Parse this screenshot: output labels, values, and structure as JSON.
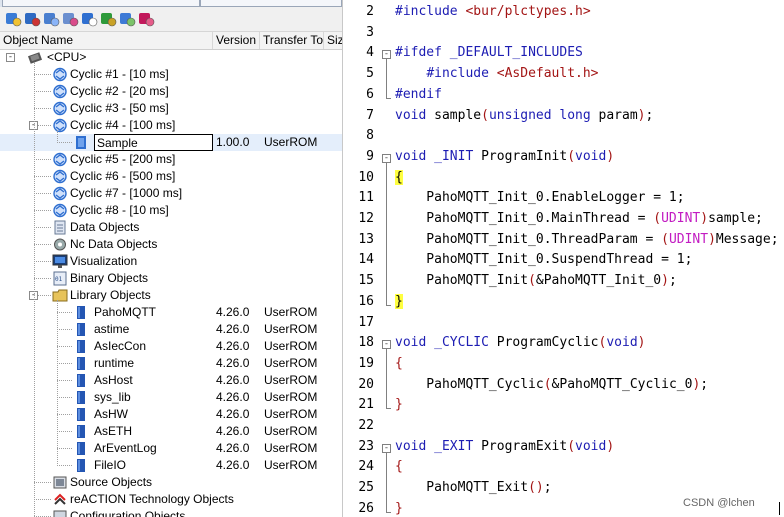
{
  "left_pane": {
    "columns": [
      "Object Name",
      "Version",
      "Transfer To",
      "Size"
    ],
    "tree": [
      {
        "label": "<CPU>",
        "version": "",
        "transfer": "",
        "icon": "cpu-icon",
        "expander": "-"
      },
      {
        "label": "Cyclic #1 - [10 ms]",
        "version": "",
        "transfer": "",
        "icon": "cyclic-icon"
      },
      {
        "label": "Cyclic #2 - [20 ms]",
        "version": "",
        "transfer": "",
        "icon": "cyclic-icon"
      },
      {
        "label": "Cyclic #3 - [50 ms]",
        "version": "",
        "transfer": "",
        "icon": "cyclic-icon"
      },
      {
        "label": "Cyclic #4 - [100 ms]",
        "version": "",
        "transfer": "",
        "icon": "cyclic-icon",
        "expander": "-"
      },
      {
        "label": "Sample",
        "version": "1.00.0",
        "transfer": "UserROM",
        "icon": "program-icon",
        "selected": true
      },
      {
        "label": "Cyclic #5 - [200 ms]",
        "version": "",
        "transfer": "",
        "icon": "cyclic-icon"
      },
      {
        "label": "Cyclic #6 - [500 ms]",
        "version": "",
        "transfer": "",
        "icon": "cyclic-icon"
      },
      {
        "label": "Cyclic #7 - [1000 ms]",
        "version": "",
        "transfer": "",
        "icon": "cyclic-icon"
      },
      {
        "label": "Cyclic #8 - [10 ms]",
        "version": "",
        "transfer": "",
        "icon": "cyclic-icon"
      },
      {
        "label": "Data Objects",
        "version": "",
        "transfer": "",
        "icon": "data-objects-icon"
      },
      {
        "label": "Nc Data Objects",
        "version": "",
        "transfer": "",
        "icon": "nc-data-icon"
      },
      {
        "label": "Visualization",
        "version": "",
        "transfer": "",
        "icon": "visualization-icon"
      },
      {
        "label": "Binary Objects",
        "version": "",
        "transfer": "",
        "icon": "binary-objects-icon"
      },
      {
        "label": "Library Objects",
        "version": "",
        "transfer": "",
        "icon": "library-objects-icon",
        "expander": "-"
      },
      {
        "label": "PahoMQTT",
        "version": "4.26.0",
        "transfer": "UserROM",
        "icon": "library-icon"
      },
      {
        "label": "astime",
        "version": "4.26.0",
        "transfer": "UserROM",
        "icon": "library-icon"
      },
      {
        "label": "AsIecCon",
        "version": "4.26.0",
        "transfer": "UserROM",
        "icon": "library-icon"
      },
      {
        "label": "runtime",
        "version": "4.26.0",
        "transfer": "UserROM",
        "icon": "library-icon"
      },
      {
        "label": "AsHost",
        "version": "4.26.0",
        "transfer": "UserROM",
        "icon": "library-icon"
      },
      {
        "label": "sys_lib",
        "version": "4.26.0",
        "transfer": "UserROM",
        "icon": "library-icon"
      },
      {
        "label": "AsHW",
        "version": "4.26.0",
        "transfer": "UserROM",
        "icon": "library-icon"
      },
      {
        "label": "AsETH",
        "version": "4.26.0",
        "transfer": "UserROM",
        "icon": "library-icon"
      },
      {
        "label": "ArEventLog",
        "version": "4.26.0",
        "transfer": "UserROM",
        "icon": "library-icon"
      },
      {
        "label": "FileIO",
        "version": "4.26.0",
        "transfer": "UserROM",
        "icon": "library-icon"
      },
      {
        "label": "Source Objects",
        "version": "",
        "transfer": "",
        "icon": "source-objects-icon"
      },
      {
        "label": "reACTION Technology Objects",
        "version": "",
        "transfer": "",
        "icon": "reaction-icon"
      },
      {
        "label": "Configuration Objects",
        "version": "",
        "transfer": "",
        "icon": "configuration-icon"
      }
    ]
  },
  "editor": {
    "lines": [
      {
        "n": "2",
        "html": "<span class=\"pp\">#include</span> <span class=\"str\">&lt;bur/plctypes.h&gt;</span>"
      },
      {
        "n": "3",
        "html": ""
      },
      {
        "n": "4",
        "html": "<span class=\"pp\">#ifdef</span> <span class=\"pp\">_DEFAULT_INCLUDES</span>"
      },
      {
        "n": "5",
        "html": "    <span class=\"pp\">#include</span> <span class=\"str\">&lt;AsDefault.h&gt;</span>"
      },
      {
        "n": "6",
        "html": "<span class=\"pp\">#endif</span>"
      },
      {
        "n": "7",
        "html": "<span class=\"kw\">void</span> sample<span class=\"pu\">(</span><span class=\"kw\">unsigned long</span> param<span class=\"pu\">)</span>;"
      },
      {
        "n": "8",
        "html": ""
      },
      {
        "n": "9",
        "html": "<span class=\"kw\">void</span> <span class=\"kw\">_INIT</span> ProgramInit<span class=\"pu\">(</span><span class=\"kw\">void</span><span class=\"pu\">)</span>"
      },
      {
        "n": "10",
        "html": "<span class=\"br-hi\">{</span>"
      },
      {
        "n": "11",
        "html": "    PahoMQTT_Init_0.EnableLogger = 1;"
      },
      {
        "n": "12",
        "html": "    PahoMQTT_Init_0.MainThread = <span class=\"pu\">(</span><span class=\"ty\">UDINT</span><span class=\"pu\">)</span>sample;"
      },
      {
        "n": "13",
        "html": "    PahoMQTT_Init_0.ThreadParam = <span class=\"pu\">(</span><span class=\"ty\">UDINT</span><span class=\"pu\">)</span>Message;"
      },
      {
        "n": "14",
        "html": "    PahoMQTT_Init_0.SuspendThread = 1;"
      },
      {
        "n": "15",
        "html": "    PahoMQTT_Init<span class=\"pu\">(</span>&amp;PahoMQTT_Init_0<span class=\"pu\">)</span>;"
      },
      {
        "n": "16",
        "html": "<span class=\"br-hi\">}</span>"
      },
      {
        "n": "17",
        "html": ""
      },
      {
        "n": "18",
        "html": "<span class=\"kw\">void</span> <span class=\"kw\">_CYCLIC</span> ProgramCyclic<span class=\"pu\">(</span><span class=\"kw\">void</span><span class=\"pu\">)</span>"
      },
      {
        "n": "19",
        "html": "<span class=\"pu\">{</span>"
      },
      {
        "n": "20",
        "html": "    PahoMQTT_Cyclic<span class=\"pu\">(</span>&amp;PahoMQTT_Cyclic_0<span class=\"pu\">)</span>;"
      },
      {
        "n": "21",
        "html": "<span class=\"pu\">}</span>"
      },
      {
        "n": "22",
        "html": ""
      },
      {
        "n": "23",
        "html": "<span class=\"kw\">void</span> <span class=\"kw\">_EXIT</span> ProgramExit<span class=\"pu\">(</span><span class=\"kw\">void</span><span class=\"pu\">)</span>"
      },
      {
        "n": "24",
        "html": "<span class=\"pu\">{</span>"
      },
      {
        "n": "25",
        "html": "    PahoMQTT_Exit<span class=\"pu\">()</span>;"
      },
      {
        "n": "26",
        "html": "<span class=\"pu\">}</span>"
      }
    ]
  },
  "watermark": "CSDN @lchen",
  "colors": {
    "keyword": "#1d1db3",
    "string": "#a31515",
    "type": "#c21cc2",
    "bracket_highlight": "#ffff40"
  }
}
